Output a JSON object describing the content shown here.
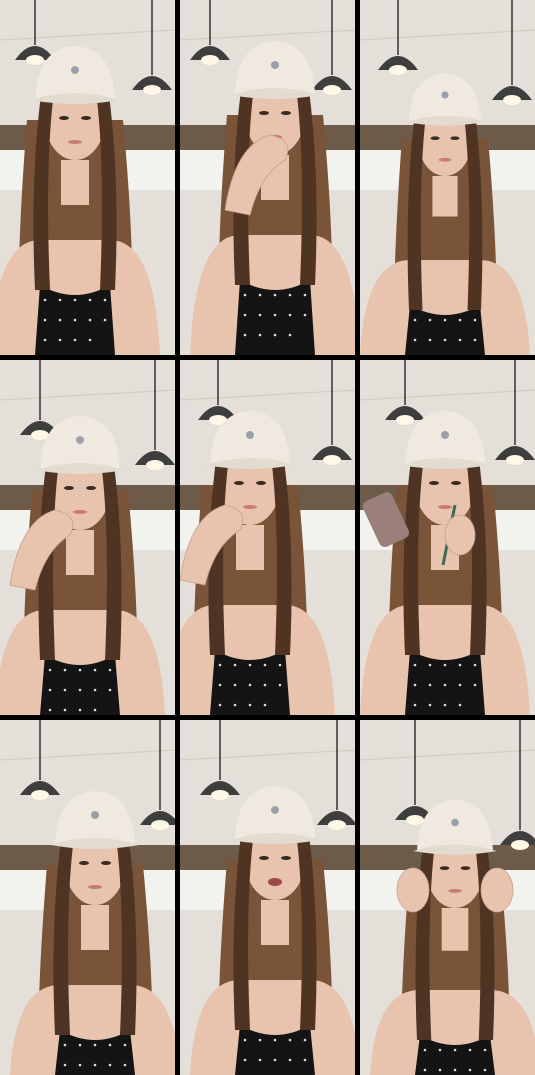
{
  "collage": {
    "rows": 3,
    "columns": 3,
    "frames": [
      {
        "id": 1,
        "pose": "looking-up-neutral",
        "hand": "none",
        "prop": "none"
      },
      {
        "id": 2,
        "pose": "hand-to-mouth",
        "hand": "right-hand-lips",
        "prop": "none"
      },
      {
        "id": 3,
        "pose": "speaking-further-back",
        "hand": "none",
        "prop": "none"
      },
      {
        "id": 4,
        "pose": "hand-to-chin",
        "hand": "left-hand-chin",
        "prop": "none"
      },
      {
        "id": 5,
        "pose": "hand-to-lips",
        "hand": "left-hand-lips",
        "prop": "none"
      },
      {
        "id": 6,
        "pose": "phone-and-pencil",
        "hand": "both",
        "prop": "phone-pencil"
      },
      {
        "id": 7,
        "pose": "tilted-head",
        "hand": "none",
        "prop": "none"
      },
      {
        "id": 8,
        "pose": "mouth-open",
        "hand": "none",
        "prop": "none"
      },
      {
        "id": 9,
        "pose": "eyes-closed-hands-at-cheeks",
        "hand": "both-cheeks",
        "prop": "none"
      }
    ]
  },
  "colors": {
    "divider": "#000000",
    "ceiling": "#e4e0d9",
    "wall_band": "#6e5a49",
    "window": "#f2f2ef",
    "hair": "#7a5438",
    "hair_dark": "#4f3424",
    "skin": "#e8c3ae",
    "cap": "#efe9df",
    "top": "#141414",
    "lamp": "#3e3e3e"
  }
}
